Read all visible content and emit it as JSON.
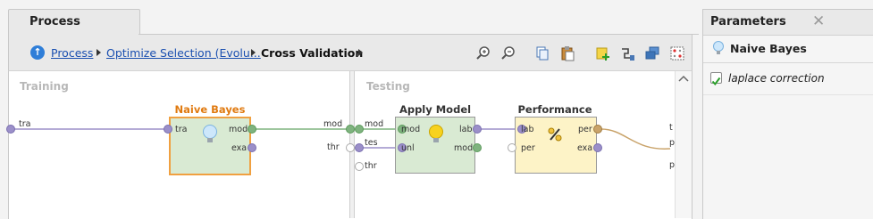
{
  "process_panel": {
    "tab_label": "Process",
    "breadcrumb": {
      "items": [
        "Process",
        "Optimize Selection (Evolu...",
        "Cross Validation"
      ]
    },
    "toolbar_icons": [
      "zoom-in-icon",
      "zoom-out-icon",
      "copy-icon",
      "paste-icon",
      "add-note-icon",
      "auto-wire-icon",
      "arrange-icon",
      "layout-icon"
    ]
  },
  "canvas": {
    "training": {
      "label": "Training",
      "input_port": "tra",
      "output_ports": [
        "mod"
      ],
      "operator": {
        "title": "Naive Bayes",
        "in_ports": [
          "tra"
        ],
        "out_ports": [
          "mod",
          "exa"
        ]
      }
    },
    "testing": {
      "label": "Testing",
      "input_ports": [
        "mod",
        "tes",
        "thr"
      ],
      "left_thr": "thr",
      "apply_model": {
        "title": "Apply Model",
        "in_ports": [
          "mod",
          "unl"
        ],
        "out_ports": [
          "lab",
          "mod"
        ]
      },
      "performance": {
        "title": "Performance",
        "in_ports": [
          "lab",
          "per"
        ],
        "out_ports": [
          "per",
          "exa"
        ]
      },
      "right_ports": [
        "t",
        "p",
        "p"
      ]
    }
  },
  "parameters": {
    "title": "Parameters",
    "operator_name": "Naive Bayes",
    "laplace_label": "laplace correction",
    "laplace_checked": true
  },
  "colors": {
    "port_purple": "#9b8fc9",
    "model_green": "#7fb37f",
    "naive_bayes_title": "#e07a10",
    "op_green_bg": "#d9ead3",
    "op_yellow_bg": "#fdf3c7",
    "link_blue": "#1a4fb0"
  }
}
